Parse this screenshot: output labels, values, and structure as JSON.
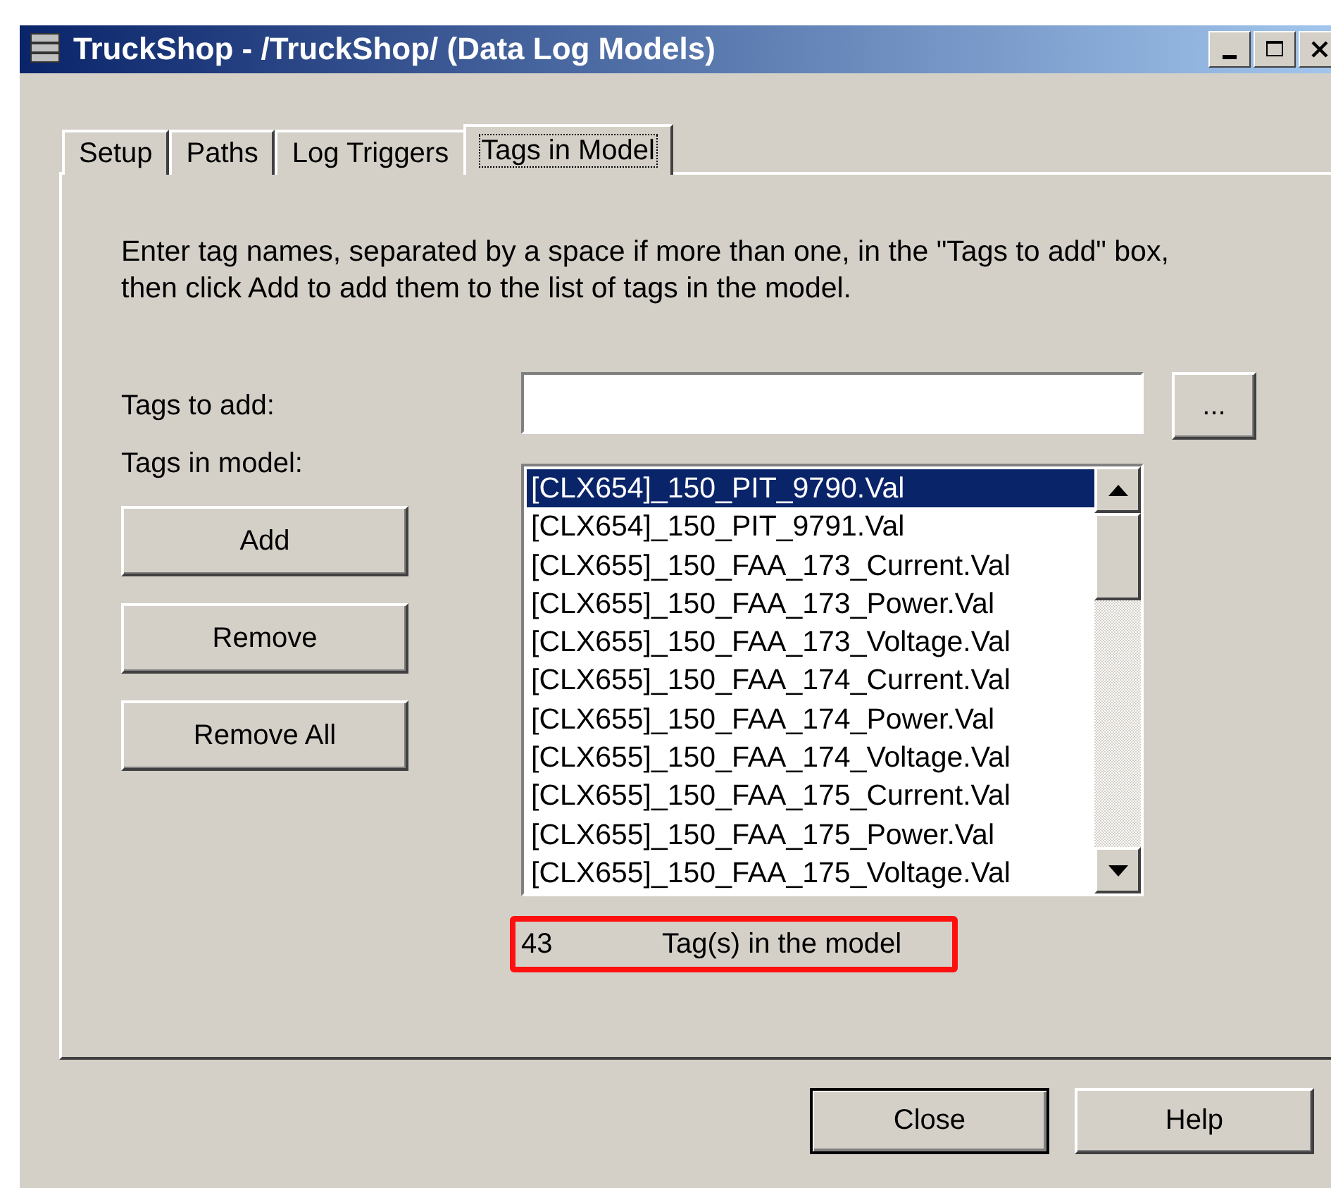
{
  "window": {
    "title": "TruckShop - /TruckShop/ (Data Log Models)"
  },
  "tabs": [
    {
      "label": "Setup",
      "selected": false
    },
    {
      "label": "Paths",
      "selected": false
    },
    {
      "label": "Log Triggers",
      "selected": false
    },
    {
      "label": "Tags in Model",
      "selected": true
    }
  ],
  "instructions": "Enter tag names, separated by a space if more than one, in the \"Tags to add\" box, then click Add to add them to the list of tags in the model.",
  "tags_to_add": {
    "label": "Tags to add:"
  },
  "browse_button": "...",
  "tags_in_model": {
    "label": "Tags in model:",
    "items": [
      {
        "text": "[CLX654]_150_PIT_9790.Val",
        "selected": true
      },
      {
        "text": "[CLX654]_150_PIT_9791.Val",
        "selected": false
      },
      {
        "text": "[CLX655]_150_FAA_173_Current.Val",
        "selected": false
      },
      {
        "text": "[CLX655]_150_FAA_173_Power.Val",
        "selected": false
      },
      {
        "text": "[CLX655]_150_FAA_173_Voltage.Val",
        "selected": false
      },
      {
        "text": "[CLX655]_150_FAA_174_Current.Val",
        "selected": false
      },
      {
        "text": "[CLX655]_150_FAA_174_Power.Val",
        "selected": false
      },
      {
        "text": "[CLX655]_150_FAA_174_Voltage.Val",
        "selected": false
      },
      {
        "text": "[CLX655]_150_FAA_175_Current.Val",
        "selected": false
      },
      {
        "text": "[CLX655]_150_FAA_175_Power.Val",
        "selected": false
      },
      {
        "text": "[CLX655]_150_FAA_175_Voltage.Val",
        "selected": false
      }
    ]
  },
  "buttons": [
    "Add",
    "Remove",
    "Remove All"
  ],
  "count": {
    "value": "43",
    "label": "Tag(s) in the model"
  },
  "footer_buttons": [
    {
      "label": "Close",
      "default": true
    },
    {
      "label": "Help",
      "default": false
    }
  ]
}
